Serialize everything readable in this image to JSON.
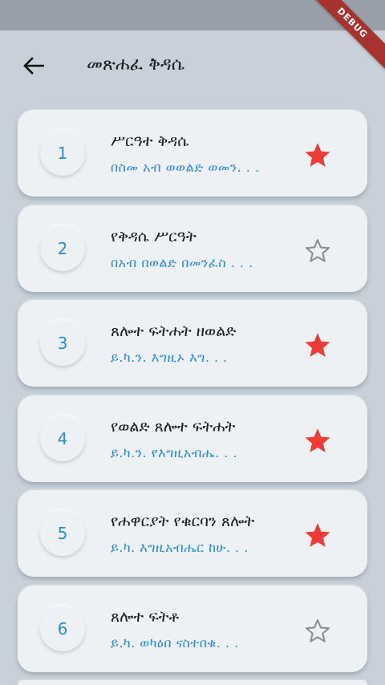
{
  "app_bar": {
    "title": "መጽሐፈ ቅዳሴ",
    "back_icon": "arrow-left-icon",
    "debug_label": "DEBUG"
  },
  "colors": {
    "accent": "#2b8cd6",
    "favorite": "#ef3b36",
    "star_outline": "#8a8f94",
    "card_bg": "#eef1f4",
    "page_bg": "#c8d1d9"
  },
  "list": {
    "items": [
      {
        "number": "1",
        "title": "ሥርዓተ ቅዳሴ",
        "subtitle": "በስመ አብ ወወልድ ወመን. . .",
        "favorite": true
      },
      {
        "number": "2",
        "title": "የቅዳሴ ሥርዓት",
        "subtitle": "በአብ በወልድ በመንፈስ . . .",
        "favorite": false
      },
      {
        "number": "3",
        "title": "ጸሎተ ፍትሐት ዘወልድ",
        "subtitle": "ይ.ካ.ን.  እግዚኦ እግ. . .",
        "favorite": true
      },
      {
        "number": "4",
        "title": "የወልድ ጸሎተ ፍትሐት",
        "subtitle": "ይ.ካ.ን.  የእግዚአብሔ. . .",
        "favorite": true
      },
      {
        "number": "5",
        "title": "የሐዋርያት የቁርባን ጸሎት",
        "subtitle": "ይ.ካ. እግዚአብሔር ከሁ. . .",
        "favorite": true
      },
      {
        "number": "6",
        "title": "ጸሎተ ፍትቶ",
        "subtitle": "ይ.ካ. ወካዕበ ናስተበቁ. . .",
        "favorite": false
      }
    ]
  }
}
